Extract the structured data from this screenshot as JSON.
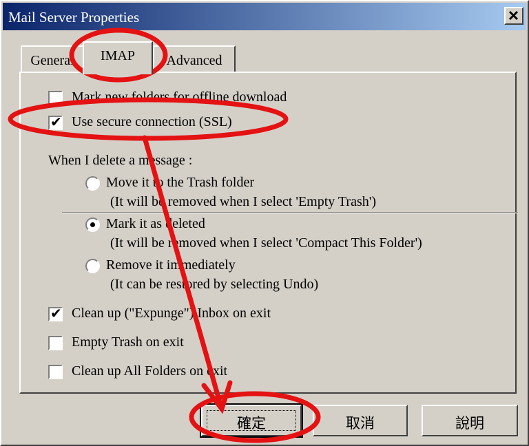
{
  "window": {
    "title": "Mail Server Properties",
    "close_label": "X"
  },
  "tabs": [
    {
      "label": "General"
    },
    {
      "label": "IMAP",
      "active": true
    },
    {
      "label": "Advanced"
    }
  ],
  "options_top": [
    {
      "label": "Mark new folders for offline download",
      "checked": false
    },
    {
      "label": "Use secure connection (SSL)",
      "checked": true
    }
  ],
  "delete_section": {
    "heading": "When I delete a message :",
    "choices": [
      {
        "label": "Move it to the Trash folder",
        "note": "(It will be removed when I select 'Empty Trash')",
        "selected": false
      },
      {
        "label": "Mark it as deleted",
        "note": "(It will be removed when I select 'Compact This Folder')",
        "selected": true
      },
      {
        "label": "Remove it immediately",
        "note": "(It can be restored by selecting Undo)",
        "selected": false
      }
    ]
  },
  "options_bottom": [
    {
      "label": "Clean up (\"Expunge\") Inbox on exit",
      "checked": true
    },
    {
      "label": "Empty Trash on exit",
      "checked": false
    },
    {
      "label": "Clean up All Folders on exit",
      "checked": false
    }
  ],
  "buttons": {
    "ok": "確定",
    "cancel": "取消",
    "help": "說明"
  },
  "annotation": {
    "color": "#e41212"
  }
}
